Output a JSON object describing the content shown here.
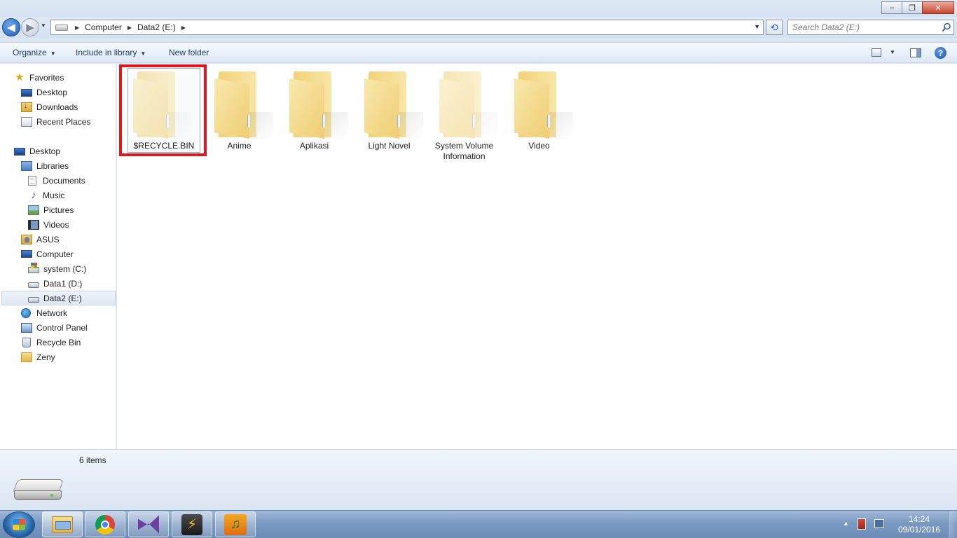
{
  "window": {
    "minimize_label": "–",
    "maximize_label": "❐",
    "close_label": "✕"
  },
  "navigation": {
    "back_label": "◀",
    "forward_label": "▶",
    "refresh_label": "⟲",
    "breadcrumb": [
      "Computer",
      "Data2 (E:)"
    ],
    "search_placeholder": "Search Data2 (E:)"
  },
  "toolbar": {
    "organize": "Organize",
    "include_in_library": "Include in library",
    "new_folder": "New folder",
    "help_label": "?"
  },
  "sidebar": {
    "items": [
      {
        "label": "Favorites",
        "icon": "star-icon",
        "level": 0
      },
      {
        "label": "Desktop",
        "icon": "desktop-icon",
        "level": 1
      },
      {
        "label": "Downloads",
        "icon": "downloads-icon",
        "level": 1
      },
      {
        "label": "Recent Places",
        "icon": "recent-places-icon",
        "level": 1
      },
      {
        "label": "Desktop",
        "icon": "desktop-icon",
        "level": 0
      },
      {
        "label": "Libraries",
        "icon": "libraries-icon",
        "level": 1
      },
      {
        "label": "Documents",
        "icon": "documents-icon",
        "level": 2
      },
      {
        "label": "Music",
        "icon": "music-icon",
        "level": 2
      },
      {
        "label": "Pictures",
        "icon": "pictures-icon",
        "level": 2
      },
      {
        "label": "Videos",
        "icon": "videos-icon",
        "level": 2
      },
      {
        "label": "ASUS",
        "icon": "user-folder-icon",
        "level": 1
      },
      {
        "label": "Computer",
        "icon": "computer-icon",
        "level": 1
      },
      {
        "label": "system (C:)",
        "icon": "system-drive-icon",
        "level": 2
      },
      {
        "label": "Data1 (D:)",
        "icon": "drive-icon",
        "level": 2
      },
      {
        "label": "Data2 (E:)",
        "icon": "drive-icon",
        "level": 2,
        "selected": true
      },
      {
        "label": "Network",
        "icon": "network-icon",
        "level": 1
      },
      {
        "label": "Control Panel",
        "icon": "control-panel-icon",
        "level": 1
      },
      {
        "label": "Recycle Bin",
        "icon": "recycle-bin-icon",
        "level": 1
      },
      {
        "label": "Zeny",
        "icon": "folder-icon",
        "level": 1
      }
    ]
  },
  "files": [
    {
      "name": "$RECYCLE.BIN",
      "hidden": true,
      "selected": true
    },
    {
      "name": "Anime",
      "hidden": false
    },
    {
      "name": "Aplikasi",
      "hidden": false
    },
    {
      "name": "Light Novel",
      "hidden": false
    },
    {
      "name": "System Volume Information",
      "hidden": true
    },
    {
      "name": "Video",
      "hidden": false
    }
  ],
  "details": {
    "item_count": "6 items"
  },
  "taskbar": {
    "winamp_glyph": "⚡",
    "music_glyph": "♫",
    "time": "14:24",
    "date": "09/01/2016"
  },
  "colors": {
    "highlight_box": "#e2161f",
    "selection_bg": "#dfe7f1"
  }
}
